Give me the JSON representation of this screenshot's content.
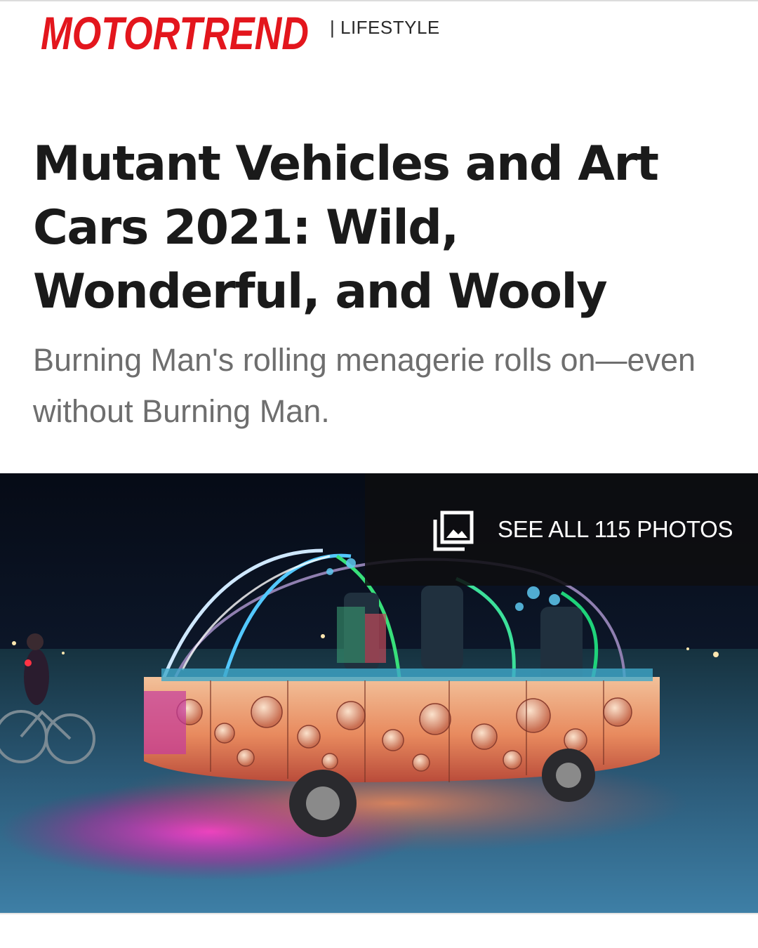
{
  "header": {
    "logo_text": "MOTORTREND",
    "section_label": "| LIFESTYLE",
    "logo_color": "#e3161d"
  },
  "article": {
    "headline": "Mutant Vehicles and Art Cars 2021: Wild, Wonderful, and Wooly",
    "dek": "Burning Man's rolling menagerie rolls on—even without Burning Man."
  },
  "hero": {
    "image_description": "Illuminated art car with glowing dome frame at night on the playa",
    "gallery_label": "SEE ALL 115 PHOTOS",
    "gallery_icon": "photo-gallery-icon"
  }
}
